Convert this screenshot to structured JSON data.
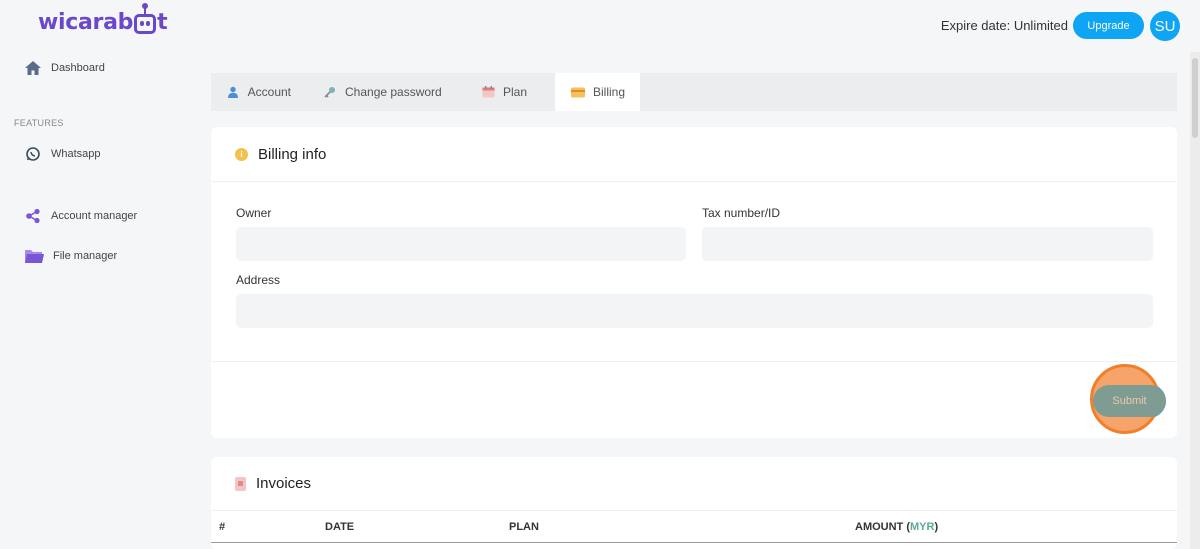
{
  "app": {
    "logo_text_left": "wicarab",
    "logo_text_right": "t"
  },
  "header": {
    "expire_label": "Expire date: Unlimited",
    "upgrade_label": "Upgrade",
    "avatar_initials": "SU"
  },
  "sidebar": {
    "section_label": "FEATURES",
    "items": [
      {
        "label": "Dashboard",
        "icon": "home-icon"
      },
      {
        "label": "Whatsapp",
        "icon": "whatsapp-icon"
      },
      {
        "label": "Account manager",
        "icon": "share-icon"
      },
      {
        "label": "File manager",
        "icon": "folder-icon"
      }
    ]
  },
  "tabs": [
    {
      "label": "Account",
      "icon": "user-icon",
      "active": false
    },
    {
      "label": "Change password",
      "icon": "key-icon",
      "active": false
    },
    {
      "label": "Plan",
      "icon": "calendar-icon",
      "active": false
    },
    {
      "label": "Billing",
      "icon": "credit-card-icon",
      "active": true
    }
  ],
  "billing": {
    "title": "Billing info",
    "owner_label": "Owner",
    "owner_value": "",
    "tax_label": "Tax number/ID",
    "tax_value": "",
    "address_label": "Address",
    "address_value": "",
    "submit_label": "Submit"
  },
  "invoices": {
    "title": "Invoices",
    "columns": {
      "index": "#",
      "date": "DATE",
      "plan": "PLAN",
      "amount": "AMOUNT",
      "currency": "MYR"
    }
  },
  "colors": {
    "brand": "#6a48c9",
    "accent": "#0ea5f5",
    "highlight": "#f07f2a"
  }
}
